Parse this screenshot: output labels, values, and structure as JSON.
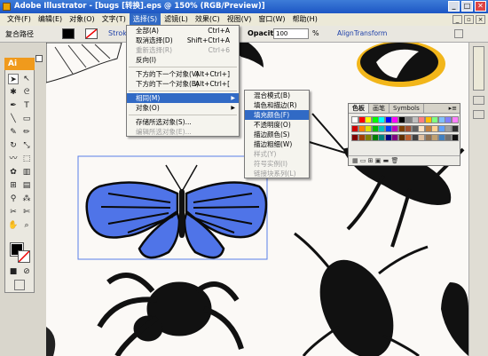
{
  "window": {
    "title": "Adobe Illustrator - [bugs [转换].eps @ 150% (RGB/Preview)]",
    "buttons": {
      "minimize": "_",
      "maximize": "□",
      "close": "✕"
    }
  },
  "menubar": {
    "items": [
      {
        "label": "文件(F)"
      },
      {
        "label": "编辑(E)"
      },
      {
        "label": "对象(O)"
      },
      {
        "label": "文字(T)"
      },
      {
        "label": "选择(S)",
        "active": true
      },
      {
        "label": "滤镜(L)"
      },
      {
        "label": "效果(C)"
      },
      {
        "label": "视图(V)"
      },
      {
        "label": "窗口(W)"
      },
      {
        "label": "帮助(H)"
      }
    ]
  },
  "controlbar": {
    "composite_path": "复合路径",
    "stroke_label": "Stroke",
    "opacity_label": "Opacity:",
    "opacity_value": "100",
    "opacity_unit": "%",
    "align_label": "Align",
    "transform_label": "Transform"
  },
  "toolbox": {
    "logo": "Ai"
  },
  "select_menu": {
    "items": [
      {
        "label": "全部(A)",
        "shortcut": "Ctrl+A"
      },
      {
        "label": "取消选择(D)",
        "shortcut": "Shift+Ctrl+A"
      },
      {
        "label": "重新选择(R)",
        "shortcut": "Ctrl+6"
      },
      {
        "label": "反向(I)",
        "shortcut": ""
      },
      {
        "label": "下方的下一个对象(V)",
        "shortcut": "Alt+Ctrl+]"
      },
      {
        "label": "下方的下一个对象(B)",
        "shortcut": "Alt+Ctrl+["
      },
      {
        "label": "相同(M)",
        "shortcut": "",
        "highlighted": true,
        "submenu": true
      },
      {
        "label": "对象(O)",
        "shortcut": "",
        "submenu": true
      },
      {
        "label": "存储所选对象(S)...",
        "shortcut": ""
      },
      {
        "label": "编辑所选对象(E)...",
        "shortcut": "",
        "disabled": true
      }
    ]
  },
  "same_submenu": {
    "items": [
      {
        "label": "混合模式(B)"
      },
      {
        "label": "填色和描边(R)"
      },
      {
        "label": "填充颜色(F)",
        "highlighted": true
      },
      {
        "label": "不透明度(O)"
      },
      {
        "label": "描边颜色(S)"
      },
      {
        "label": "描边粗细(W)"
      },
      {
        "label": "样式(Y)",
        "disabled": true
      },
      {
        "label": "符号实例(I)",
        "disabled": true
      },
      {
        "label": "链接块系列(L)",
        "disabled": true
      }
    ]
  },
  "swatches_panel": {
    "tabs": [
      "色板",
      "画笔",
      "Symbols"
    ],
    "options_icon": "▸≡",
    "footer": "▦ ▭ ⊞  ▣ ▬ 🗑",
    "colors": [
      "#ffffff",
      "#ff0000",
      "#ffff00",
      "#00ff00",
      "#00ffff",
      "#0000ff",
      "#ff00ff",
      "#000000",
      "#808080",
      "#c0c0c0",
      "#ff8080",
      "#ffc000",
      "#80ff80",
      "#80c0ff",
      "#8080ff",
      "#ff80ff",
      "#d00000",
      "#ff8000",
      "#e0e000",
      "#00c000",
      "#00c0c0",
      "#0040ff",
      "#c000c0",
      "#804000",
      "#a05030",
      "#606060",
      "#ffe0c0",
      "#c08040",
      "#ffd090",
      "#60a0ff",
      "#a0a0a0",
      "#303030",
      "#800000",
      "#a04000",
      "#808000",
      "#008000",
      "#008080",
      "#000080",
      "#800080",
      "#603000",
      "#c06030",
      "#404040",
      "#e0c0a0",
      "#907050",
      "#c0a070",
      "#4080c0",
      "#707070",
      "#101010"
    ]
  }
}
